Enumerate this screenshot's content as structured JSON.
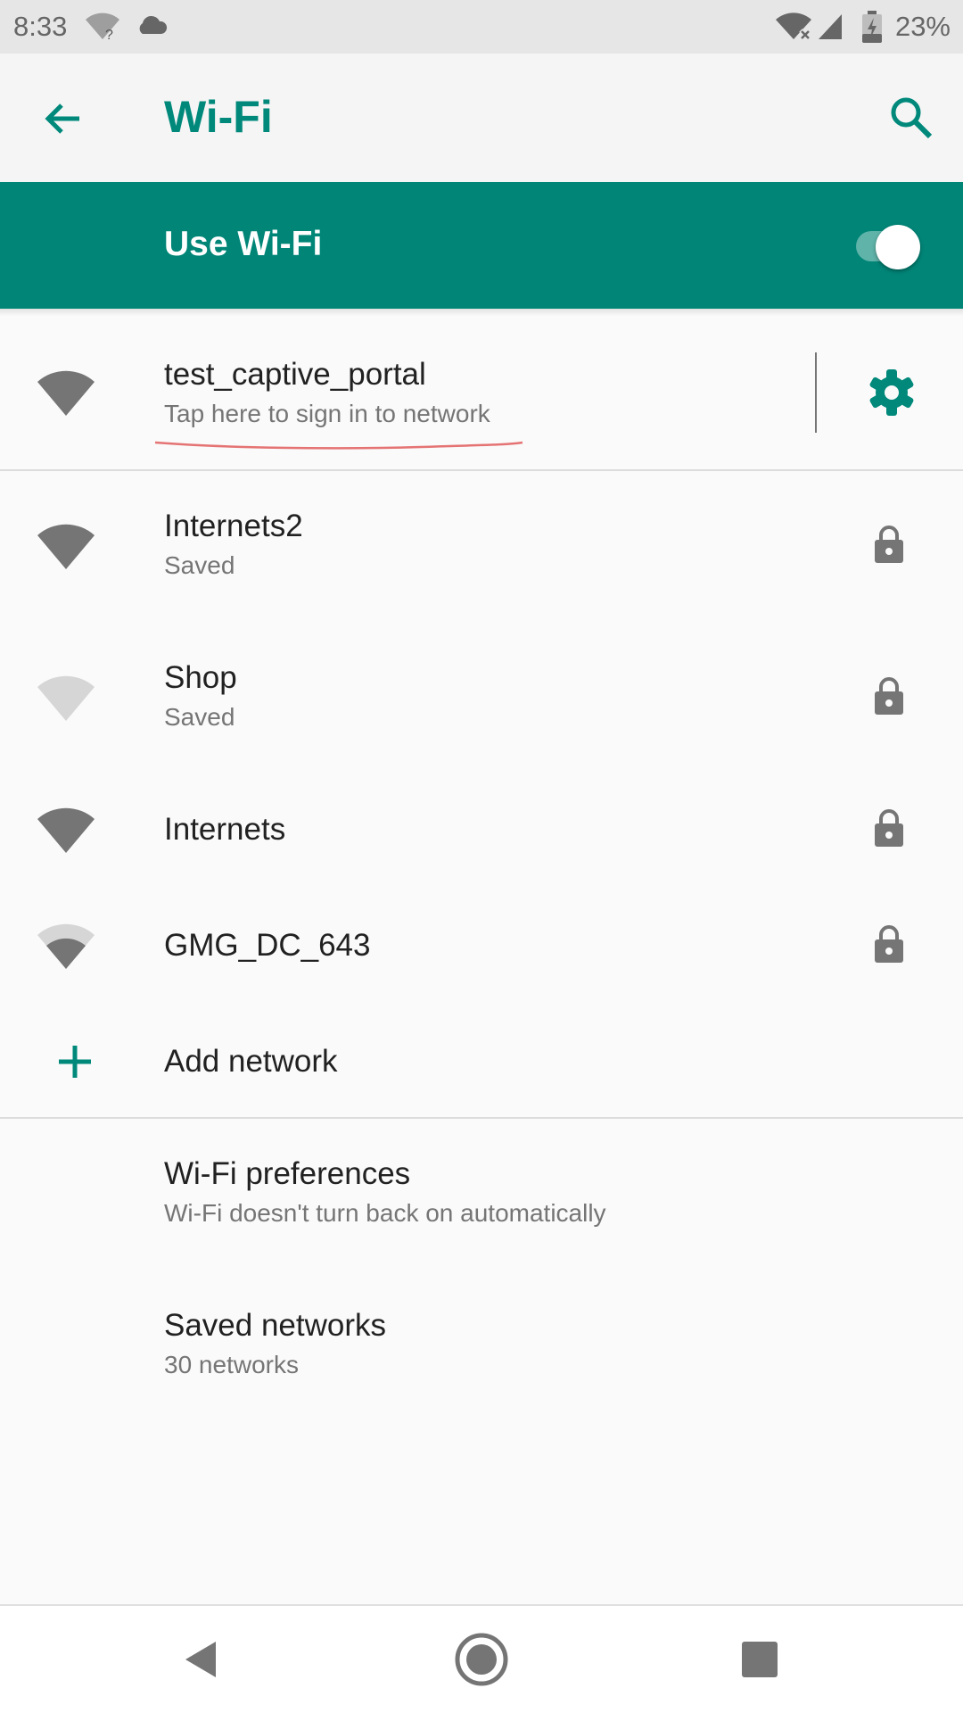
{
  "status_bar": {
    "time": "8:33",
    "battery": "23%",
    "icons": [
      "wifi-unknown-icon",
      "cloud-icon",
      "wifi-no-internet-icon",
      "cell-signal-icon",
      "battery-charging-icon"
    ]
  },
  "app_bar": {
    "title": "Wi-Fi",
    "back_icon": "arrow-back-icon",
    "search_icon": "search-icon"
  },
  "master_switch": {
    "label": "Use Wi-Fi",
    "enabled": true
  },
  "connected_network": {
    "name": "test_captive_portal",
    "summary": "Tap here to sign in to network",
    "settings_icon": "gear-icon"
  },
  "networks": [
    {
      "name": "Internets2",
      "summary": "Saved",
      "secured": true
    },
    {
      "name": "Shop",
      "summary": "Saved",
      "secured": true
    },
    {
      "name": "Internets",
      "summary": "",
      "secured": true
    },
    {
      "name": "GMG_DC_643",
      "summary": "",
      "secured": true
    }
  ],
  "add_network": {
    "label": "Add network",
    "icon": "plus-icon"
  },
  "preferences": {
    "wifi_prefs": {
      "title": "Wi-Fi preferences",
      "summary": "Wi-Fi doesn't turn back on automatically"
    },
    "saved_networks": {
      "title": "Saved networks",
      "summary": "30 networks"
    }
  },
  "colors": {
    "accent": "#00897b",
    "switch_bar": "#008577",
    "icon_gray": "#757575",
    "annotation": "#e57373"
  },
  "nav_bar": {
    "back_icon": "nav-back-icon",
    "home_icon": "nav-home-icon",
    "recents_icon": "nav-recents-icon"
  }
}
